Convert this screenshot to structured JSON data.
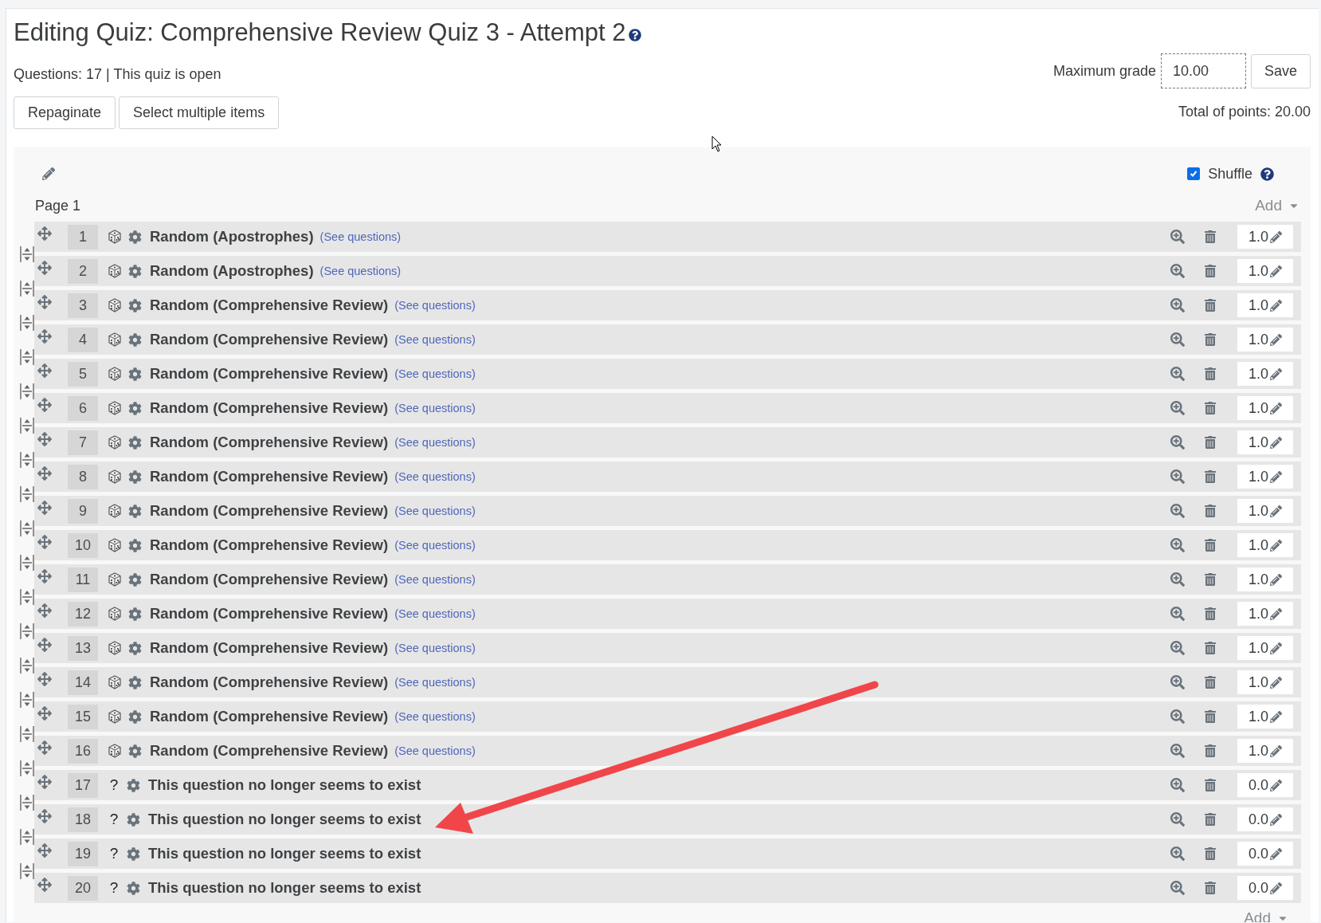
{
  "title": "Editing Quiz: Comprehensive Review Quiz 3 - Attempt 2",
  "summary": "Questions: 17 | This quiz is open",
  "buttons": [
    "Repaginate",
    "Select multiple items"
  ],
  "max_grade": {
    "label": "Maximum grade",
    "value": "10.00",
    "button": "Save"
  },
  "total_points": "Total of points: 20.00",
  "shuffle": {
    "label": "Shuffle",
    "checked": true
  },
  "page": {
    "title": "Page 1",
    "add": "Add",
    "questions": [
      {
        "number": "1",
        "kind": "random",
        "title": "Random (Apostrophes)",
        "link": "(See questions)",
        "mark": "1.0"
      },
      {
        "number": "2",
        "kind": "random",
        "title": "Random (Apostrophes)",
        "link": "(See questions)",
        "mark": "1.0"
      },
      {
        "number": "3",
        "kind": "random",
        "title": "Random (Comprehensive Review)",
        "link": "(See questions)",
        "mark": "1.0"
      },
      {
        "number": "4",
        "kind": "random",
        "title": "Random (Comprehensive Review)",
        "link": "(See questions)",
        "mark": "1.0"
      },
      {
        "number": "5",
        "kind": "random",
        "title": "Random (Comprehensive Review)",
        "link": "(See questions)",
        "mark": "1.0"
      },
      {
        "number": "6",
        "kind": "random",
        "title": "Random (Comprehensive Review)",
        "link": "(See questions)",
        "mark": "1.0"
      },
      {
        "number": "7",
        "kind": "random",
        "title": "Random (Comprehensive Review)",
        "link": "(See questions)",
        "mark": "1.0"
      },
      {
        "number": "8",
        "kind": "random",
        "title": "Random (Comprehensive Review)",
        "link": "(See questions)",
        "mark": "1.0"
      },
      {
        "number": "9",
        "kind": "random",
        "title": "Random (Comprehensive Review)",
        "link": "(See questions)",
        "mark": "1.0"
      },
      {
        "number": "10",
        "kind": "random",
        "title": "Random (Comprehensive Review)",
        "link": "(See questions)",
        "mark": "1.0"
      },
      {
        "number": "11",
        "kind": "random",
        "title": "Random (Comprehensive Review)",
        "link": "(See questions)",
        "mark": "1.0"
      },
      {
        "number": "12",
        "kind": "random",
        "title": "Random (Comprehensive Review)",
        "link": "(See questions)",
        "mark": "1.0"
      },
      {
        "number": "13",
        "kind": "random",
        "title": "Random (Comprehensive Review)",
        "link": "(See questions)",
        "mark": "1.0"
      },
      {
        "number": "14",
        "kind": "random",
        "title": "Random (Comprehensive Review)",
        "link": "(See questions)",
        "mark": "1.0"
      },
      {
        "number": "15",
        "kind": "random",
        "title": "Random (Comprehensive Review)",
        "link": "(See questions)",
        "mark": "1.0"
      },
      {
        "number": "16",
        "kind": "random",
        "title": "Random (Comprehensive Review)",
        "link": "(See questions)",
        "mark": "1.0"
      },
      {
        "number": "17",
        "kind": "missing",
        "icon": "?",
        "title": "This question no longer seems to exist",
        "mark": "0.0"
      },
      {
        "number": "18",
        "kind": "missing",
        "icon": "?",
        "title": "This question no longer seems to exist",
        "mark": "0.0"
      },
      {
        "number": "19",
        "kind": "missing",
        "icon": "?",
        "title": "This question no longer seems to exist",
        "mark": "0.0"
      },
      {
        "number": "20",
        "kind": "missing",
        "icon": "?",
        "title": "This question no longer seems to exist",
        "mark": "0.0"
      }
    ]
  },
  "bottom_add": "Add"
}
